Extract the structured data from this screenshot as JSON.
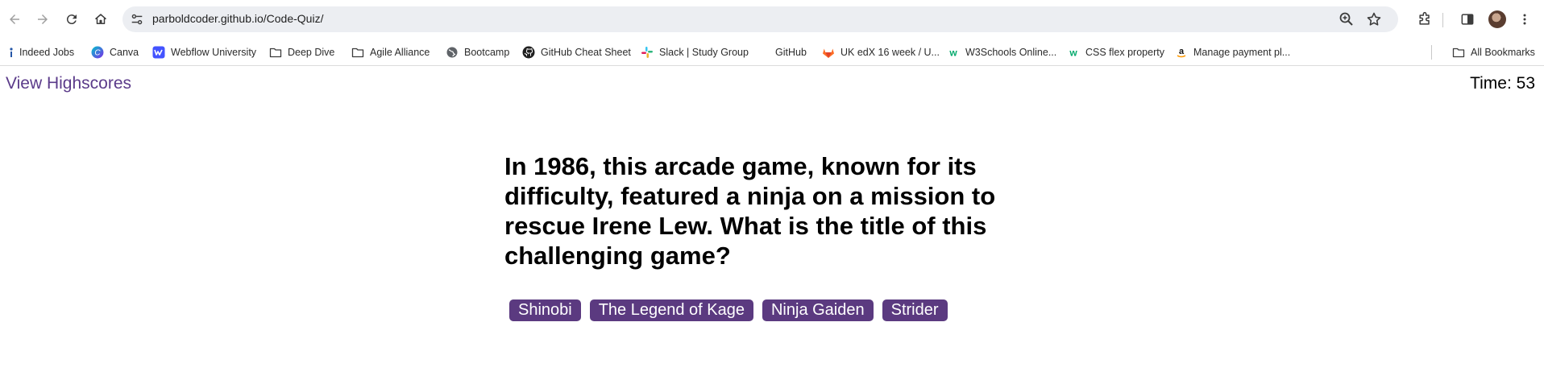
{
  "browser": {
    "url": "parboldcoder.github.io/Code-Quiz/"
  },
  "bookmarks": [
    {
      "label": "Indeed Jobs",
      "icon": "indeed-icon"
    },
    {
      "label": "Canva",
      "icon": "canva-icon"
    },
    {
      "label": "Webflow University",
      "icon": "webflow-icon"
    },
    {
      "label": "Deep Dive",
      "icon": "folder-icon"
    },
    {
      "label": "Agile Alliance",
      "icon": "folder-icon"
    },
    {
      "label": "Bootcamp",
      "icon": "globe-icon"
    },
    {
      "label": "GitHub Cheat Sheet",
      "icon": "github-icon"
    },
    {
      "label": "Slack | Study Group",
      "icon": "slack-icon"
    },
    {
      "label": "GitHub",
      "icon": "none"
    },
    {
      "label": "UK edX 16 week / U...",
      "icon": "gitlab-icon"
    },
    {
      "label": "W3Schools Online...",
      "icon": "w3schools-icon"
    },
    {
      "label": "CSS flex property",
      "icon": "w3schools-icon"
    },
    {
      "label": "Manage payment pl...",
      "icon": "amazon-icon"
    }
  ],
  "all_bookmarks_label": "All Bookmarks",
  "quiz": {
    "view_highscores": "View Highscores",
    "timer_label": "Time:",
    "timer_value": "53",
    "question": "In 1986, this arcade game, known for its difficulty, featured a ninja on a mission to rescue Irene Lew. What is the title of this challenging game?",
    "choices": [
      "Shinobi",
      "The Legend of Kage",
      "Ninja Gaiden",
      "Strider"
    ]
  },
  "colors": {
    "accent": "#5b3a80",
    "link": "#5b3b8a"
  }
}
